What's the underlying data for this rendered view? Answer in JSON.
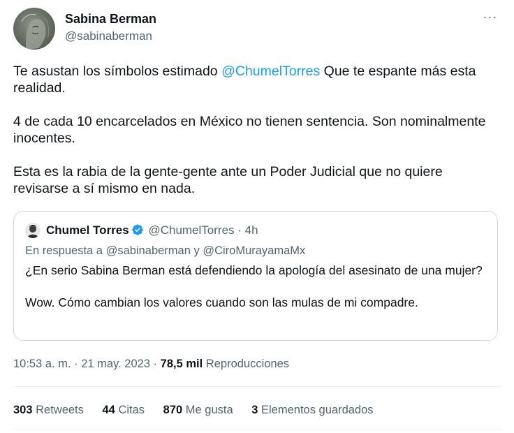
{
  "author": {
    "name": "Sabina Berman",
    "handle": "@sabinaberman"
  },
  "tweet": {
    "p1_pre": "Te asustan los símbolos estimado ",
    "p1_mention": "@ChumelTorres",
    "p1_post": " Que te espante más esta realidad.",
    "p2": "4 de cada 10 encarcelados en México no tienen sentencia. Son nominalmente inocentes.",
    "p3": "Esta es la rabia de la gente-gente ante un Poder Judicial que no quiere revisarse a sí mismo en nada."
  },
  "quote": {
    "name": "Chumel Torres",
    "handle": "@ChumelTorres",
    "separator": "·",
    "age": "4h",
    "reply_prefix": "En respuesta a ",
    "reply_user1": "@sabinaberman",
    "reply_and": " y ",
    "reply_user2": "@CiroMurayamaMx",
    "p1": "¿En serio Sabina Berman está defendiendo la apología del asesinato de una mujer?",
    "p2": "Wow. Cómo cambian los valores cuando son las mulas de mi compadre."
  },
  "meta": {
    "time": "10:53 a. m.",
    "sep1": " · ",
    "date": "21 may. 2023",
    "sep2": " · ",
    "views": "78,5 mil",
    "views_label": " Reproducciones"
  },
  "stats": {
    "retweets_count": "303",
    "retweets_label": " Retweets",
    "quotes_count": "44",
    "quotes_label": " Citas",
    "likes_count": "870",
    "likes_label": " Me gusta",
    "bookmarks_count": "3",
    "bookmarks_label": " Elementos guardados"
  },
  "colors": {
    "link": "#1d9bf0",
    "secondary_text": "#536471",
    "border": "#cfd9de"
  },
  "icons": {
    "more": "more-options-icon",
    "verified": "verified-badge-icon"
  }
}
